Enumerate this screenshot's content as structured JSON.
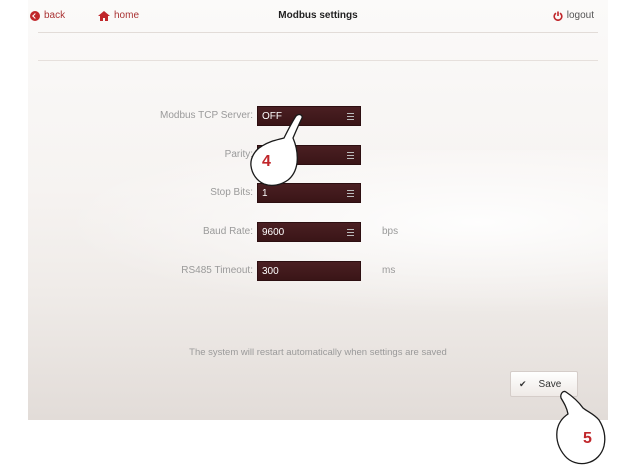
{
  "topbar": {
    "back_label": "back",
    "home_label": "home",
    "title": "Modbus settings",
    "logout_label": "logout"
  },
  "form": {
    "modbus_tcp_server": {
      "label": "Modbus TCP Server:",
      "value": "OFF"
    },
    "parity": {
      "label": "Parity:",
      "value": ""
    },
    "stop_bits": {
      "label": "Stop Bits:",
      "value": "1"
    },
    "baud_rate": {
      "label": "Baud Rate:",
      "value": "9600",
      "unit": "bps"
    },
    "rs485_timeout": {
      "label": "RS485 Timeout:",
      "value": "300",
      "unit": "ms"
    }
  },
  "notice": "The system will restart automatically when settings are saved",
  "save": {
    "label": "Save"
  },
  "annotations": {
    "step4": "4",
    "step5": "5"
  },
  "colors": {
    "accent": "#c0262a",
    "field_bg": "#3e181a"
  },
  "icons": {
    "back": "back-arrow-circle-icon",
    "home": "home-icon",
    "logout": "power-icon",
    "select": "menu-icon",
    "save": "check-icon"
  }
}
